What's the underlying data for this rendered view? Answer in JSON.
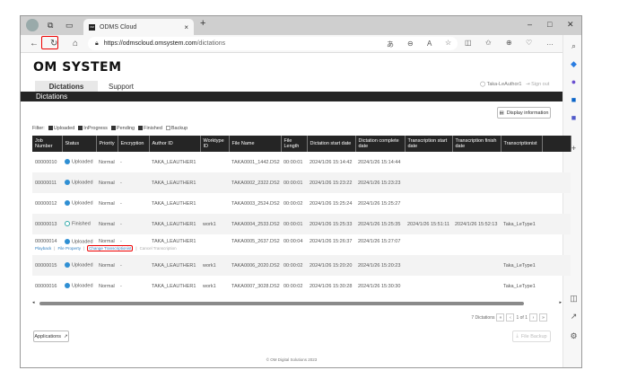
{
  "browser": {
    "tab_title": "ODMS Cloud",
    "url_host": "https://odmscloud.omsystem.com",
    "url_path": "/dictations",
    "favicon_text": "OM"
  },
  "header": {
    "logo": "OM SYSTEM",
    "tabs": [
      "Dictations",
      "Support"
    ],
    "user": "Taka-LeAuthor1",
    "signout": "Sign out",
    "section_title": "Dictations"
  },
  "toolbar": {
    "display_info": "Display information"
  },
  "filter": {
    "label": "Filter:",
    "options": [
      {
        "label": "Uploaded",
        "checked": true
      },
      {
        "label": "InProgress",
        "checked": true
      },
      {
        "label": "Pending",
        "checked": true
      },
      {
        "label": "Finished",
        "checked": true
      },
      {
        "label": "Backup",
        "checked": false
      }
    ]
  },
  "table": {
    "columns": [
      "Job Number",
      "Status",
      "Priority",
      "Encryption",
      "Author ID",
      "Worktype ID",
      "File Name",
      "File Length",
      "Dictation start date",
      "Dictation complete date",
      "Transcription start date",
      "Transcription finish date",
      "Transcriptionist",
      ""
    ],
    "rows": [
      [
        "00000010",
        "Uploaded",
        "Normal",
        "-",
        "TAKA_LEAUTHER1",
        "",
        "TAKA0001_1442.DS2",
        "00:00:01",
        "2024/1/26 15:14:42",
        "2024/1/26 15:14:44",
        "",
        "",
        ""
      ],
      [
        "00000011",
        "Uploaded",
        "Normal",
        "-",
        "TAKA_LEAUTHER1",
        "",
        "TAKA0002_2322.DS2",
        "00:00:01",
        "2024/1/26 15:23:22",
        "2024/1/26 15:23:23",
        "",
        "",
        ""
      ],
      [
        "00000012",
        "Uploaded",
        "Normal",
        "-",
        "TAKA_LEAUTHER1",
        "",
        "TAKA0003_2524.DS2",
        "00:00:02",
        "2024/1/26 15:25:24",
        "2024/1/26 15:25:27",
        "",
        "",
        ""
      ],
      [
        "00000013",
        "Finished",
        "Normal",
        "-",
        "TAKA_LEAUTHER1",
        "work1",
        "TAKA0004_2533.DS2",
        "00:00:01",
        "2024/1/26 15:25:33",
        "2024/1/26 15:25:35",
        "2024/1/26 15:51:11",
        "2024/1/26 15:52:13",
        "Taka_LeType1"
      ],
      [
        "00000014",
        "Uploaded",
        "Normal",
        "-",
        "TAKA_LEAUTHER1",
        "",
        "TAKA0005_2637.DS2",
        "00:00:04",
        "2024/1/26 15:26:37",
        "2024/1/26 15:27:07",
        "",
        "",
        ""
      ],
      [
        "00000015",
        "Uploaded",
        "Normal",
        "-",
        "TAKA_LEAUTHER1",
        "work1",
        "TAKA0006_2020.DS2",
        "00:00:02",
        "2024/1/26 15:20:20",
        "2024/1/26 15:20:23",
        "",
        "",
        "Taka_LeType1"
      ],
      [
        "00000016",
        "Uploaded",
        "Normal",
        "-",
        "TAKA_LEAUTHER1",
        "work1",
        "TAKA0007_3028.DS2",
        "00:00:02",
        "2024/1/26 15:30:28",
        "2024/1/26 15:30:30",
        "",
        "",
        "Taka_LeType1"
      ]
    ],
    "row_actions": [
      "Playback",
      "File Property",
      "Change Transcriptionist",
      "Cancel Transcription"
    ]
  },
  "pagination": {
    "count": "7 Dictations",
    "page": "1 of 1"
  },
  "footer_buttons": {
    "applications": "Applications",
    "file_backup": "File Backup"
  },
  "footer": "© OM Digital Solutions 2023"
}
